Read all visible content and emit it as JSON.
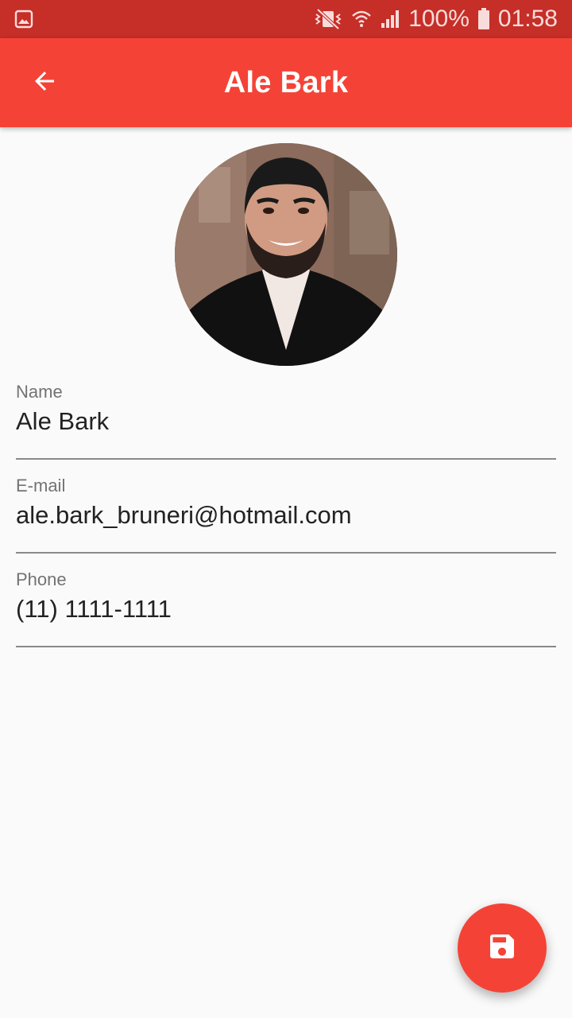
{
  "status_bar": {
    "battery": "100%",
    "time": "01:58",
    "icons": [
      "gallery-icon",
      "vibrate-icon",
      "wifi-icon",
      "signal-icon",
      "battery-icon"
    ]
  },
  "app_bar": {
    "title": "Ale Bark",
    "back_icon": "arrow-back-icon",
    "color": "#f44336"
  },
  "contact": {
    "avatar": "profile-photo",
    "fields": {
      "name": {
        "label": "Name",
        "value": "Ale Bark"
      },
      "email": {
        "label": "E-mail",
        "value": "ale.bark_bruneri@hotmail.com"
      },
      "phone": {
        "label": "Phone",
        "value": "(11) 1111-1111"
      }
    }
  },
  "fab": {
    "icon": "save-icon",
    "color": "#f44336"
  }
}
